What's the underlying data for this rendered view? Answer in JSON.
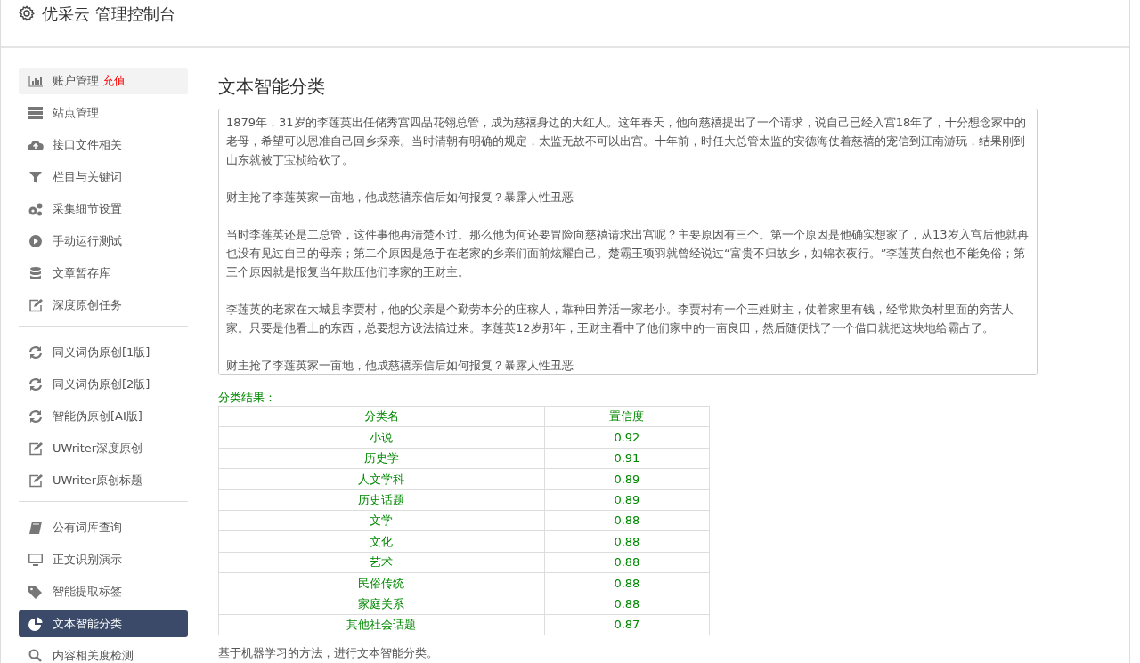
{
  "header": {
    "title": "优采云 管理控制台"
  },
  "sidebar": {
    "groups": [
      {
        "items": [
          {
            "label": "账户管理",
            "tag": "充值",
            "kind": "bars",
            "highlighted": true,
            "selected": false
          },
          {
            "label": "站点管理",
            "kind": "server",
            "highlighted": false,
            "selected": false
          },
          {
            "label": "接口文件相关",
            "kind": "cloud",
            "highlighted": false,
            "selected": false
          },
          {
            "label": "栏目与关键词",
            "kind": "filter",
            "highlighted": false,
            "selected": false
          },
          {
            "label": "采集细节设置",
            "kind": "gears",
            "highlighted": false,
            "selected": false
          },
          {
            "label": "手动运行测试",
            "kind": "play",
            "highlighted": false,
            "selected": false
          },
          {
            "label": "文章暂存库",
            "kind": "database",
            "highlighted": false,
            "selected": false
          },
          {
            "label": "深度原创任务",
            "kind": "edit",
            "highlighted": false,
            "selected": false
          }
        ]
      },
      {
        "items": [
          {
            "label": "同义词伪原创[1版]",
            "kind": "refresh",
            "highlighted": false,
            "selected": false
          },
          {
            "label": "同义词伪原创[2版]",
            "kind": "refresh",
            "highlighted": false,
            "selected": false
          },
          {
            "label": "智能伪原创[AI版]",
            "kind": "refresh",
            "highlighted": false,
            "selected": false
          },
          {
            "label": "UWriter深度原创",
            "kind": "edit",
            "highlighted": false,
            "selected": false
          },
          {
            "label": "UWriter原创标题",
            "kind": "edit",
            "highlighted": false,
            "selected": false
          }
        ]
      },
      {
        "items": [
          {
            "label": "公有词库查询",
            "kind": "book",
            "highlighted": false,
            "selected": false
          },
          {
            "label": "正文识别演示",
            "kind": "monitor",
            "highlighted": false,
            "selected": false
          },
          {
            "label": "智能提取标签",
            "kind": "tag",
            "highlighted": false,
            "selected": false
          },
          {
            "label": "文本智能分类",
            "kind": "pie",
            "highlighted": false,
            "selected": true
          },
          {
            "label": "内容相关度检测",
            "kind": "search",
            "highlighted": false,
            "selected": false
          }
        ]
      }
    ]
  },
  "main": {
    "title": "文本智能分类",
    "input_text": [
      "1879年，31岁的李莲英出任储秀宫四品花翎总管，成为慈禧身边的大红人。这年春天，他向慈禧提出了一个请求，说自己已经入宫18年了，十分想念家中的老母，希望可以恩准自己回乡探亲。当时清朝有明确的规定，太监无故不可以出宫。十年前，时任大总管太监的安德海仗着慈禧的宠信到江南游玩，结果刚到山东就被丁宝桢给砍了。",
      "财主抢了李莲英家一亩地，他成慈禧亲信后如何报复？暴露人性丑恶",
      "当时李莲英还是二总管，这件事他再清楚不过。那么他为何还要冒险向慈禧请求出宫呢？主要原因有三个。第一个原因是他确实想家了，从13岁入宫后他就再也没有见过自己的母亲；第二个原因是急于在老家的乡亲们面前炫耀自己。楚霸王项羽就曾经说过“富贵不归故乡，如锦衣夜行。”李莲英自然也不能免俗；第三个原因就是报复当年欺压他们李家的王财主。",
      "李莲英的老家在大城县李贾村，他的父亲是个勤劳本分的庄稼人，靠种田养活一家老小。李贾村有一个王姓财主，仗着家里有钱，经常欺负村里面的穷苦人家。只要是他看上的东西，总要想方设法搞过来。李莲英12岁那年，王财主看中了他们家中的一亩良田，然后随便找了一个借口就把这块地给霸占了。",
      "财主抢了李莲英家一亩地，他成慈禧亲信后如何报复？暴露人性丑恶"
    ],
    "result_label": "分类结果：",
    "table": {
      "columns": [
        "分类名",
        "置信度"
      ],
      "rows": [
        [
          "小说",
          "0.92"
        ],
        [
          "历史学",
          "0.91"
        ],
        [
          "人文学科",
          "0.89"
        ],
        [
          "历史话题",
          "0.89"
        ],
        [
          "文学",
          "0.88"
        ],
        [
          "文化",
          "0.88"
        ],
        [
          "艺术",
          "0.88"
        ],
        [
          "民俗传统",
          "0.88"
        ],
        [
          "家庭关系",
          "0.88"
        ],
        [
          "其他社会话题",
          "0.87"
        ]
      ]
    },
    "note": "基于机器学习的方法，进行文本智能分类。"
  }
}
